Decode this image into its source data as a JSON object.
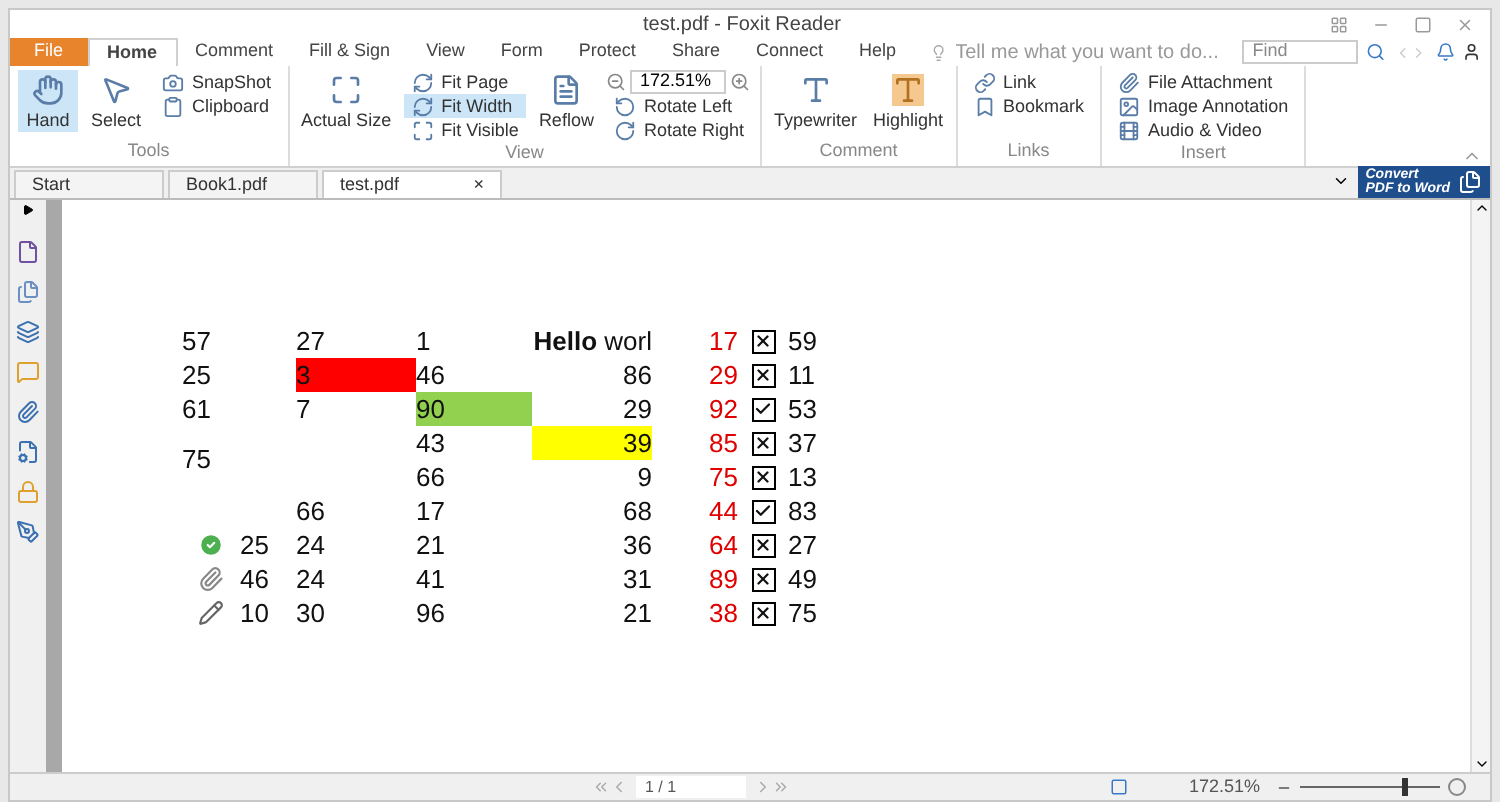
{
  "window": {
    "title": "test.pdf - Foxit Reader"
  },
  "menu_tabs": [
    {
      "label": "File",
      "selected": false,
      "kind": "file"
    },
    {
      "label": "Home",
      "selected": true,
      "kind": "tab"
    },
    {
      "label": "Comment",
      "selected": false,
      "kind": "tab"
    },
    {
      "label": "Fill & Sign",
      "selected": false,
      "kind": "tab"
    },
    {
      "label": "View",
      "selected": false,
      "kind": "tab"
    },
    {
      "label": "Form",
      "selected": false,
      "kind": "tab"
    },
    {
      "label": "Protect",
      "selected": false,
      "kind": "tab"
    },
    {
      "label": "Share",
      "selected": false,
      "kind": "tab"
    },
    {
      "label": "Connect",
      "selected": false,
      "kind": "tab"
    },
    {
      "label": "Help",
      "selected": false,
      "kind": "tab"
    }
  ],
  "tell_me": {
    "placeholder": "Tell me what you want to do..."
  },
  "find": {
    "placeholder": "Find"
  },
  "ribbon": {
    "tools": {
      "label": "Tools",
      "hand": {
        "label": "Hand",
        "selected": true
      },
      "select": {
        "label": "Select"
      },
      "snapshot": "SnapShot",
      "clipboard": "Clipboard"
    },
    "view": {
      "label": "View",
      "actual_size": "Actual Size",
      "fit_page": {
        "label": "Fit Page",
        "selected": false
      },
      "fit_width": {
        "label": "Fit Width",
        "selected": true
      },
      "fit_visible": {
        "label": "Fit Visible",
        "selected": false
      },
      "reflow": "Reflow",
      "zoom": "172.51%",
      "rotate_left": "Rotate Left",
      "rotate_right": "Rotate Right"
    },
    "comment": {
      "label": "Comment",
      "typewriter": "Typewriter",
      "highlight": "Highlight"
    },
    "links": {
      "label": "Links",
      "link": "Link",
      "bookmark": "Bookmark"
    },
    "insert": {
      "label": "Insert",
      "items": [
        "File Attachment",
        "Image Annotation",
        "Audio & Video"
      ]
    }
  },
  "doc_tabs": [
    {
      "label": "Start",
      "selected": false
    },
    {
      "label": "Book1.pdf",
      "selected": false
    },
    {
      "label": "test.pdf",
      "selected": true,
      "close": "×"
    }
  ],
  "banner": {
    "line1": "Convert",
    "line2": "PDF to Word"
  },
  "sheet": [
    {
      "c1": {
        "text": "57"
      },
      "c2": {
        "text": "27"
      },
      "c3": {
        "text": "1"
      },
      "c4": {
        "text": "**Hello** worl"
      },
      "c5": "17",
      "kind": "cross",
      "c7": "59"
    },
    {
      "c1": {
        "text": "25"
      },
      "c2": {
        "text": "3",
        "color": "#ff0000"
      },
      "c3": {
        "text": "46"
      },
      "c4": {
        "text": "86"
      },
      "c5": "29",
      "kind": "cross",
      "c7": "11"
    },
    {
      "c1": {
        "text": "61"
      },
      "c2": {
        "text": "7"
      },
      "c3": {
        "text": "90",
        "color": "#92d050"
      },
      "c4": {
        "text": "29"
      },
      "c5": "92",
      "kind": "tick",
      "c7": "53"
    },
    {
      "c1": {
        "text": "75",
        "merged": true
      },
      "c3": {
        "text": "43"
      },
      "c4": {
        "text": "39",
        "color": "#ffff00"
      },
      "c5": "85",
      "kind": "cross",
      "c7": "37"
    },
    {
      "c3": {
        "text": "66"
      },
      "c4": {
        "text": "9"
      },
      "c5": "75",
      "kind": "cross",
      "c7": "13"
    },
    {
      "c2": {
        "text": "66"
      },
      "c3": {
        "text": "17"
      },
      "c4": {
        "text": "68"
      },
      "c5": "44",
      "kind": "tick",
      "c7": "83"
    },
    {
      "c1": {
        "text": "25",
        "kind": "check"
      },
      "c2": {
        "text": "24"
      },
      "c3": {
        "text": "21"
      },
      "c4": {
        "text": "36"
      },
      "c5": "64",
      "kind": "cross",
      "c7": "27"
    },
    {
      "c1": {
        "text": "46",
        "kind": "clip"
      },
      "c2": {
        "text": "24"
      },
      "c3": {
        "text": "41"
      },
      "c4": {
        "text": "31"
      },
      "c5": "89",
      "kind": "cross",
      "c7": "49"
    },
    {
      "c1": {
        "text": "10",
        "kind": "pencil"
      },
      "c2": {
        "text": "30"
      },
      "c3": {
        "text": "96"
      },
      "c4": {
        "text": "21"
      },
      "c5": "38",
      "kind": "cross",
      "c7": "75"
    }
  ],
  "status": {
    "page": "1 / 1",
    "zoom": "172.51%",
    "zoom_slider": {
      "level": 0.73
    }
  }
}
